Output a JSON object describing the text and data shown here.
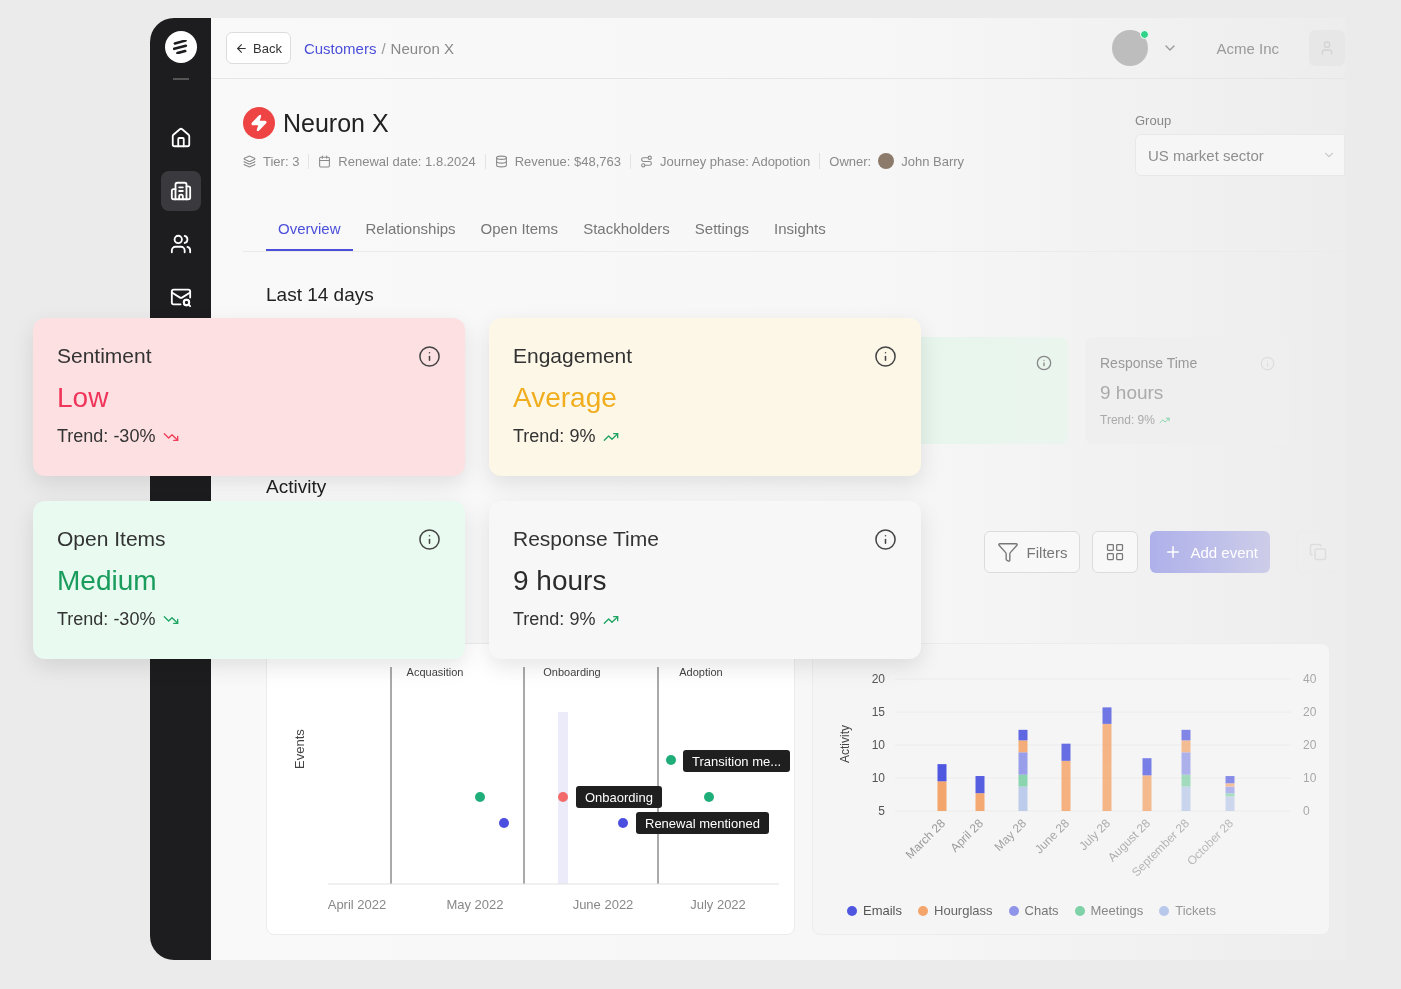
{
  "sidebar": {
    "items": [
      {
        "kind": "home",
        "selected": false
      },
      {
        "kind": "accounts",
        "selected": true
      },
      {
        "kind": "contacts",
        "selected": false
      },
      {
        "kind": "inbox",
        "selected": false
      }
    ]
  },
  "topbar": {
    "back": "Back",
    "breadcrumb": [
      {
        "label": "Customers",
        "link": true
      },
      {
        "label": "Neuron X",
        "link": false
      }
    ],
    "separator": "/",
    "company": "Acme Inc"
  },
  "customer": {
    "name": "Neuron X",
    "meta": [
      {
        "kind": "tier",
        "text": "Tier: 3"
      },
      {
        "kind": "renewal",
        "text": "Renewal date: 1.8.2024"
      },
      {
        "kind": "revenue",
        "text": "Revenue: $48,763"
      },
      {
        "kind": "journey",
        "text": "Journey phase: Adopotion"
      },
      {
        "kind": "owner",
        "label": "Owner:",
        "text": "John Barry"
      }
    ]
  },
  "group": {
    "label": "Group",
    "value": "US market sector"
  },
  "tabs": [
    {
      "label": "Overview",
      "selected": true
    },
    {
      "label": "Relationships",
      "selected": false
    },
    {
      "label": "Open Items",
      "selected": false
    },
    {
      "label": "Stackholders",
      "selected": false
    },
    {
      "label": "Settings",
      "selected": false
    },
    {
      "label": "Insights",
      "selected": false
    }
  ],
  "period": "Last 14 days",
  "background_cards": [
    {
      "kind": "covered"
    },
    {
      "kind": "metric",
      "title": "Response Time",
      "value": "9 hours",
      "trend_label": "Trend:",
      "trend": "9%"
    }
  ],
  "metric_cards": [
    {
      "title": "Sentiment",
      "value": "Low",
      "trend_label": "Trend:",
      "trend": "-30%",
      "trend_up": false,
      "kind": "negative"
    },
    {
      "title": "Engagement",
      "value": "Average",
      "trend_label": "Trend:",
      "trend": "9%",
      "trend_up": true,
      "kind": "warning"
    },
    {
      "title": "Open Items",
      "value": "Medium",
      "trend_label": "Trend:",
      "trend": "-30%",
      "trend_up": false,
      "kind": "positive"
    },
    {
      "title": "Response Time",
      "value": "9 hours",
      "trend_label": "Trend:",
      "trend": "9%",
      "trend_up": true,
      "kind": "neutral"
    }
  ],
  "activity": {
    "title": "Activity",
    "filters": "Filters",
    "add": "Add event"
  },
  "timeline": {
    "ylabel": "Events",
    "phases": [
      "Acquasition",
      "Onboarding",
      "Adoption"
    ],
    "xlabels": [
      "April 2022",
      "May 2022",
      "June 2022",
      "July 2022"
    ],
    "events": [
      {
        "color": "#1fae7a",
        "label": "Transition me..."
      },
      {
        "color": "#1fae7a"
      },
      {
        "color": "#f26a6a",
        "label": "Onbaording"
      },
      {
        "color": "#1fae7a"
      },
      {
        "color": "#4b4fe0"
      },
      {
        "color": "#4b4fe0",
        "label": "Renewal mentioned"
      }
    ]
  },
  "activity_chart": {
    "right_axis_labels": [
      "40",
      "20",
      "20",
      "10",
      "0"
    ],
    "lower_tick_labels": [
      "10",
      "5"
    ],
    "chart_data": {
      "type": "bar",
      "stacked": true,
      "ylabel": "Activity",
      "ylim": [
        0,
        20
      ],
      "categories": [
        "March 28",
        "April 28",
        "May 28",
        "June 28",
        "July 28",
        "August 28",
        "September 28",
        "October 28"
      ],
      "yticks": [
        20,
        15,
        10
      ],
      "series": [
        {
          "name": "Tickets",
          "color": "#b7c8ea",
          "values": [
            0,
            0,
            3.7,
            0,
            0,
            0,
            3.7,
            2.2
          ]
        },
        {
          "name": "Meetings",
          "color": "#7fd1a8",
          "values": [
            0,
            0,
            1.8,
            0,
            0,
            0,
            1.8,
            0.5
          ]
        },
        {
          "name": "Chats",
          "color": "#8f95e8",
          "values": [
            0,
            0,
            3.4,
            0,
            0,
            0,
            3.4,
            1
          ]
        },
        {
          "name": "Hourglass",
          "color": "#f4a56b",
          "values": [
            4.5,
            2.7,
            1.8,
            7.6,
            13.2,
            5.4,
            1.8,
            0.5
          ]
        },
        {
          "name": "Emails",
          "color": "#4f57e0",
          "values": [
            2.6,
            2.6,
            1.6,
            2.6,
            2.5,
            2.6,
            1.6,
            1.1
          ]
        }
      ]
    }
  }
}
